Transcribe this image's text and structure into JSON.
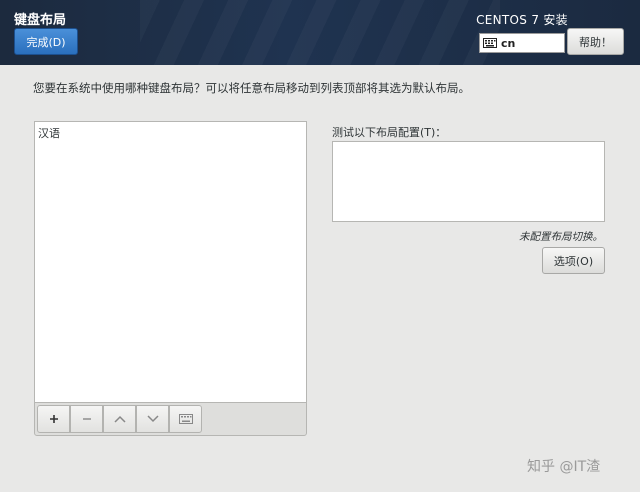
{
  "header": {
    "title": "键盘布局",
    "done_label": "完成(D)",
    "product": "CENTOS 7 安装",
    "keyboard_indicator": "cn",
    "help_label": "帮助！",
    "accent_color": "#3a80cd"
  },
  "main": {
    "instruction": "您要在系统中使用哪种键盘布局？可以将任意布局移动到列表顶部将其选为默认布局。",
    "layouts": [
      "汉语"
    ],
    "toolbar": {
      "add_icon": "plus-icon",
      "remove_icon": "minus-icon",
      "up_icon": "chevron-up-icon",
      "down_icon": "chevron-down-icon",
      "preview_icon": "keyboard-icon"
    },
    "test_label": "测试以下布局配置(T)：",
    "test_value": "",
    "no_switch_note": "未配置布局切换。",
    "options_label": "选项(O)"
  },
  "watermark": "知乎 @IT渣"
}
